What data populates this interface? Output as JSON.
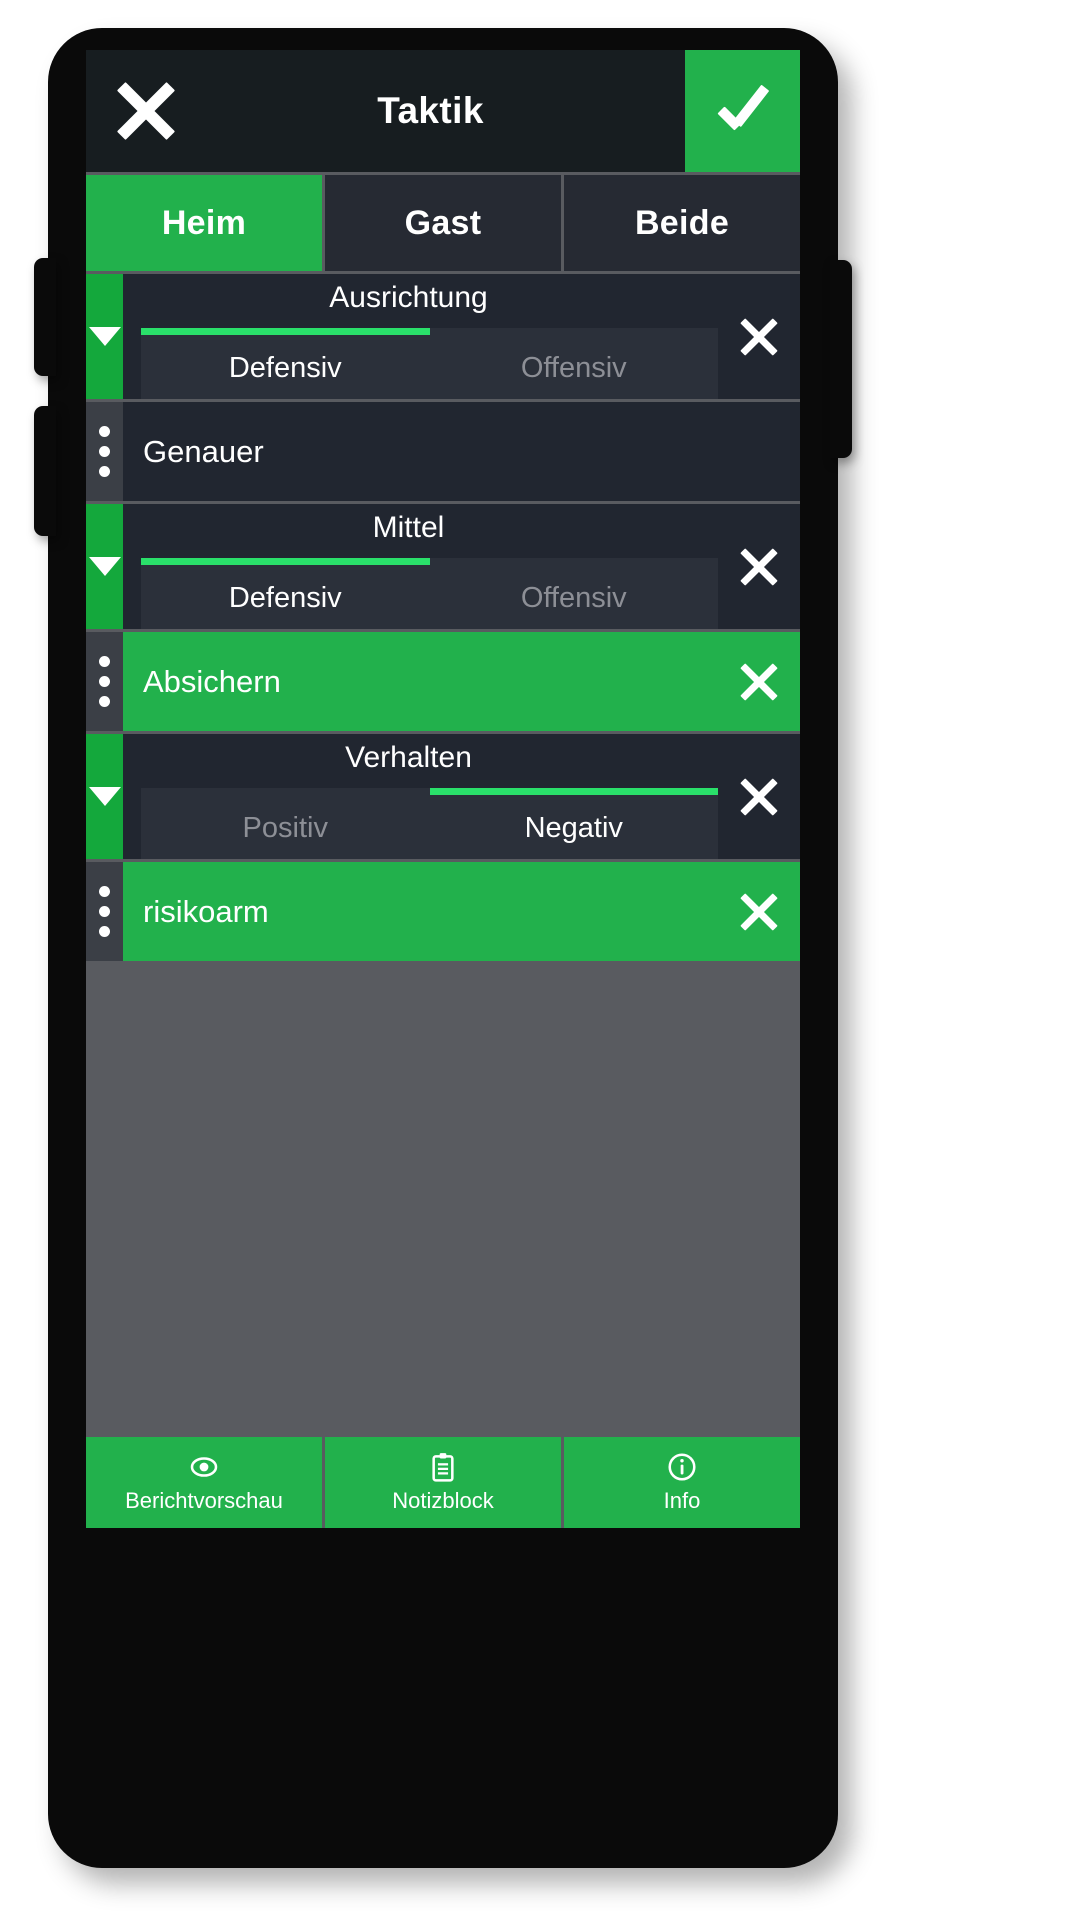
{
  "header": {
    "title": "Taktik",
    "close_icon": "close-x-icon",
    "confirm_icon": "checkmark-icon"
  },
  "team_tabs": [
    {
      "label": "Heim",
      "active": true
    },
    {
      "label": "Gast",
      "active": false
    },
    {
      "label": "Beide",
      "active": false
    }
  ],
  "rows": [
    {
      "type": "slider",
      "caption": "Ausrichtung",
      "left_label": "Defensiv",
      "right_label": "Offensiv",
      "selected_side": "left",
      "fill_start_pct": 0,
      "fill_end_pct": 50,
      "handle_icon": "triangle-down-icon",
      "close_icon": "close-x-icon"
    },
    {
      "type": "text",
      "label": "Genauer",
      "highlighted": false,
      "handle_icon": "kebab-menu-icon",
      "close_icon": null
    },
    {
      "type": "slider",
      "caption": "Mittel",
      "left_label": "Defensiv",
      "right_label": "Offensiv",
      "selected_side": "left",
      "fill_start_pct": 0,
      "fill_end_pct": 50,
      "handle_icon": "triangle-down-icon",
      "close_icon": "close-x-icon"
    },
    {
      "type": "text",
      "label": "Absichern",
      "highlighted": true,
      "handle_icon": "kebab-menu-icon",
      "close_icon": "close-x-icon"
    },
    {
      "type": "slider",
      "caption": "Verhalten",
      "left_label": "Positiv",
      "right_label": "Negativ",
      "selected_side": "right",
      "fill_start_pct": 50,
      "fill_end_pct": 100,
      "handle_icon": "triangle-down-icon",
      "close_icon": "close-x-icon"
    },
    {
      "type": "text",
      "label": "risikoarm",
      "highlighted": true,
      "handle_icon": "kebab-menu-icon",
      "close_icon": "close-x-icon"
    }
  ],
  "bottom_bar": [
    {
      "label": "Berichtvorschau",
      "icon": "eye-icon"
    },
    {
      "label": "Notizblock",
      "icon": "clipboard-icon"
    },
    {
      "label": "Info",
      "icon": "info-circle-icon"
    }
  ],
  "colors": {
    "accent_green": "#22b14c",
    "slider_fill_green": "#2ae06a",
    "panel_dark": "#212630",
    "titlebar_dark": "#171d20",
    "screen_bg": "#595b60"
  }
}
